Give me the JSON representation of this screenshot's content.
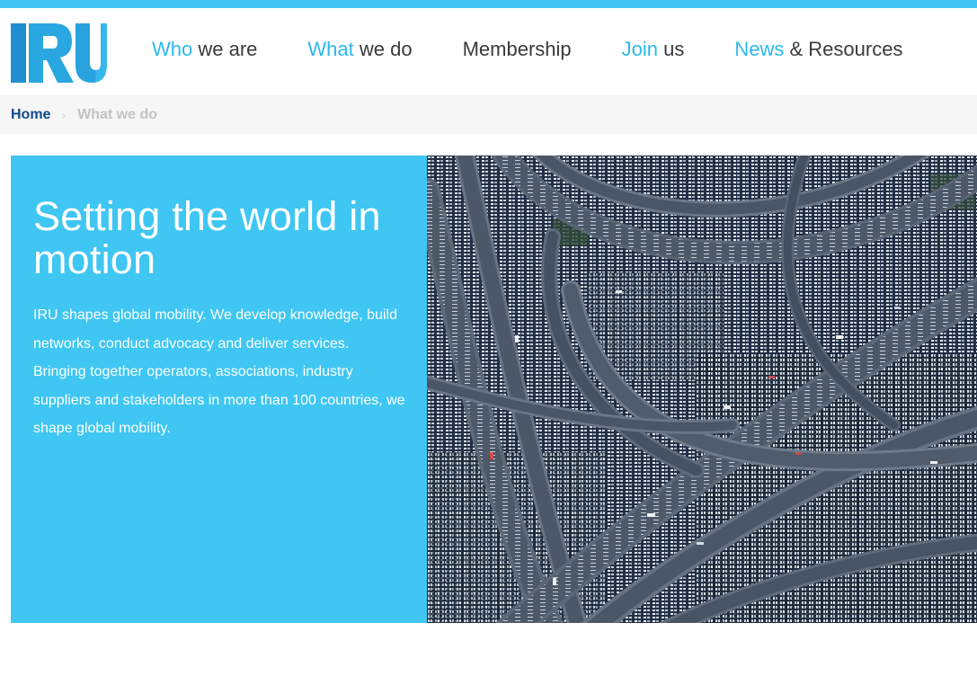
{
  "header": {
    "logo_text": "IRU",
    "nav": [
      {
        "accent": "Who",
        "rest": " we are"
      },
      {
        "accent": "What",
        "rest": " we do"
      },
      {
        "accent": "",
        "rest": "Membership"
      },
      {
        "accent": "Join",
        "rest": " us"
      },
      {
        "accent": "News",
        "rest": " & Resources"
      }
    ]
  },
  "breadcrumb": {
    "home": "Home",
    "separator": "›",
    "current": "What we do"
  },
  "hero": {
    "title": "Setting the world in motion",
    "body": "IRU shapes global mobility. We develop knowledge, build networks, conduct advocacy and deliver services. Bringing together operators, associations, industry suppliers and stakeholders in more than 100 countries, we shape global mobility.",
    "image_subject": "aerial-highway-interchange-photo"
  },
  "colors": {
    "brand_cyan": "#3fc6f3",
    "brand_blue": "#2db8ec",
    "brand_navy": "#0e4a8a",
    "text_dark": "#3a3a3c"
  }
}
